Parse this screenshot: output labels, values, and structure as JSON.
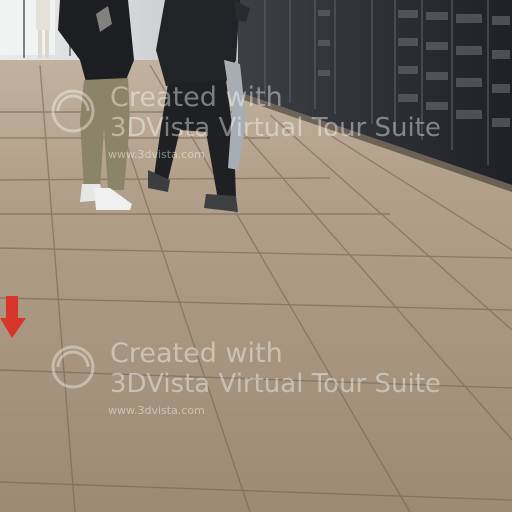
{
  "watermark": {
    "line1": "Created with",
    "line2": "3DVista Virtual Tour Suite",
    "url": "www.3dvista.com",
    "logo_icon": "3dvista-logo-icon"
  },
  "hotspot": {
    "icon": "arrow-down-icon",
    "color": "#d8352a"
  },
  "colors": {
    "floor": "#a99580",
    "grout": "#6e6152",
    "lockers": "#2b2e33",
    "wall_light": "#cfd3d6"
  }
}
